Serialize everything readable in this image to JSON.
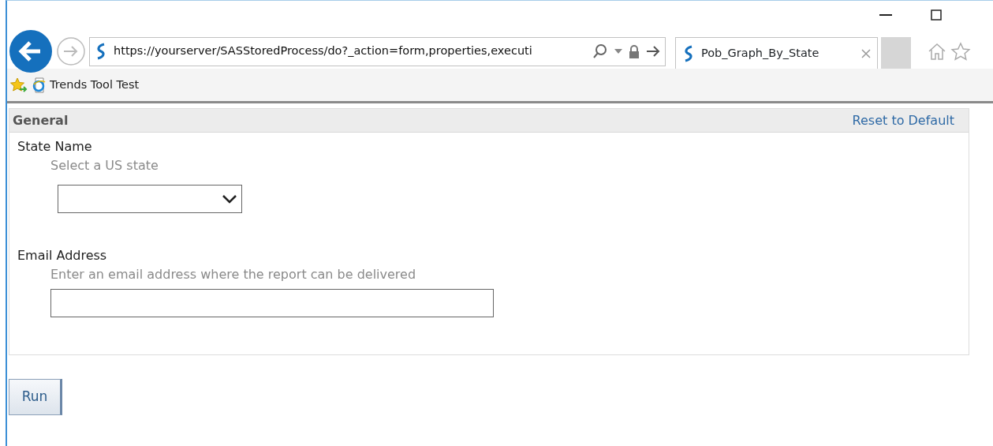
{
  "browser": {
    "address": "https://yourserver/SASStoredProcess/do?_action=form,properties,executi",
    "tab": {
      "title": "Pob_Graph_By_State",
      "selected": true
    },
    "favorites": [
      {
        "label": "Trends Tool Test"
      }
    ]
  },
  "form": {
    "section": "General",
    "reset_link": "Reset to Default",
    "fields": [
      {
        "kind": "select",
        "label": "State Name",
        "hint": "Select a US state"
      },
      {
        "kind": "text",
        "label": "Email Address",
        "hint": "Enter an email address where the report can be delivered"
      }
    ]
  },
  "buttons": [
    {
      "label": "Run"
    }
  ]
}
